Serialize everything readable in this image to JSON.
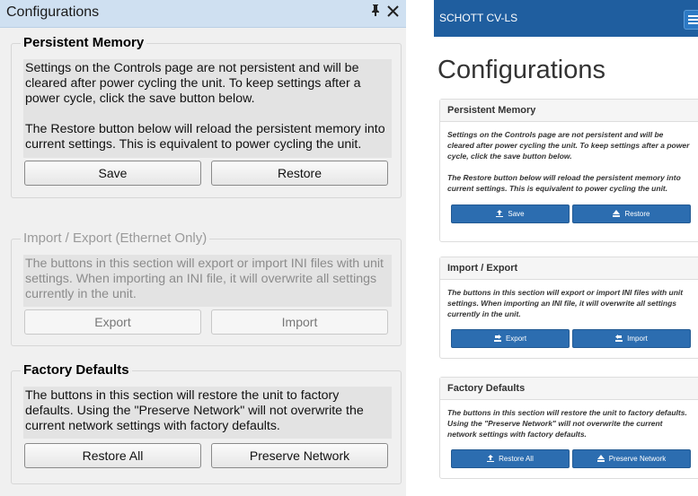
{
  "left_panel": {
    "title": "Configurations",
    "pin_glyph": "I",
    "close_glyph": "✕",
    "persistent": {
      "title": "Persistent Memory",
      "para1": "Settings on the Controls page are not persistent and will be cleared after power cycling the unit. To keep settings after a power cycle, click the save button below.",
      "para2": "The Restore button below will reload the persistent memory into current settings. This is equivalent to power cycling the unit.",
      "save_label": "Save",
      "restore_label": "Restore"
    },
    "import_export": {
      "title": "Import / Export (Ethernet Only)",
      "text": "The buttons in this section will export or import INI files with unit settings. When importing an INI file, it will overwrite all settings currently in the unit.",
      "export_label": "Export",
      "import_label": "Import"
    },
    "factory": {
      "title": "Factory Defaults",
      "text": "The buttons in this section will restore the unit to factory defaults. Using the \"Preserve Network\" will not overwrite the current network settings with factory defaults.",
      "restore_all_label": "Restore All",
      "preserve_label": "Preserve Network"
    }
  },
  "web_page": {
    "brand": "SCHOTT CV-LS",
    "page_title": "Configurations",
    "persistent": {
      "title": "Persistent Memory",
      "para1": "Settings on the Controls page are not persistent and will be cleared after power cycling the unit. To keep settings after a power cycle, click the save button below.",
      "para2": "The Restore button below will reload the persistent memory into current settings. This is equivalent to power cycling the unit.",
      "save_label": "Save",
      "restore_label": "Restore"
    },
    "import_export": {
      "title": "Import / Export",
      "text": "The buttons in this section will export or import INI files with unit settings. When importing an INI file, it will overwrite all settings currently in the unit.",
      "export_label": "Export",
      "import_label": "Import"
    },
    "factory": {
      "title": "Factory Defaults",
      "text": "The buttons in this section will restore the unit to factory defaults. Using the \"Preserve Network\" will not overwrite the current network settings with factory defaults.",
      "restore_all_label": "Restore All",
      "preserve_label": "Preserve Network"
    }
  },
  "colors": {
    "navbar": "#1f5e9f",
    "button_blue": "#2c6db0",
    "titlebar": "#cfe0f1"
  },
  "icons": {
    "save": "upload-icon",
    "restore": "eject-icon",
    "export": "export-icon",
    "import": "import-icon",
    "menu": "hamburger-icon"
  }
}
